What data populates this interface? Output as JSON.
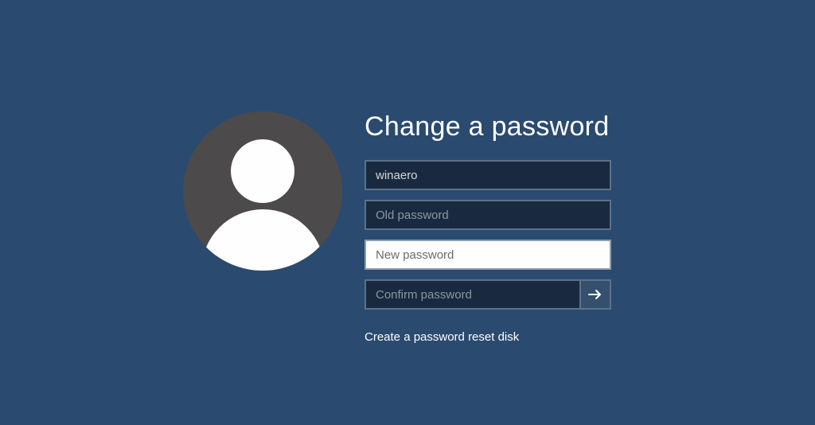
{
  "title": "Change a password",
  "username": {
    "value": "winaero"
  },
  "old_password": {
    "placeholder": "Old password",
    "value": ""
  },
  "new_password": {
    "placeholder": "New password",
    "value": ""
  },
  "confirm_password": {
    "placeholder": "Confirm password",
    "value": ""
  },
  "reset_link": "Create a password reset disk"
}
